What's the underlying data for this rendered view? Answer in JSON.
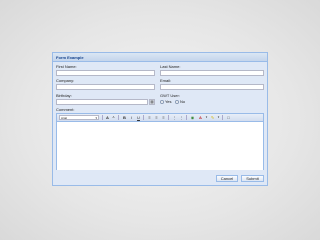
{
  "form": {
    "title": "Form Example",
    "first_name_label": "First Name:",
    "last_name_label": "Last Name:",
    "company_label": "Company:",
    "email_label": "Email:",
    "birthday_label": "Birthday:",
    "gwt_user_label": "GWT User:",
    "radio_yes": "Yes",
    "radio_no": "No",
    "comment_label": "Comment:",
    "font_value": "Arial",
    "cancel_label": "Cancel",
    "submit_label": "Submit"
  },
  "toolbar_icons": {
    "grow": "A",
    "shrink": "A",
    "bold": "B",
    "italic": "I",
    "underline": "U"
  },
  "colors": {
    "panel_bg": "#dfe8f6",
    "header_text": "#15428b",
    "border": "#99bbe8"
  }
}
